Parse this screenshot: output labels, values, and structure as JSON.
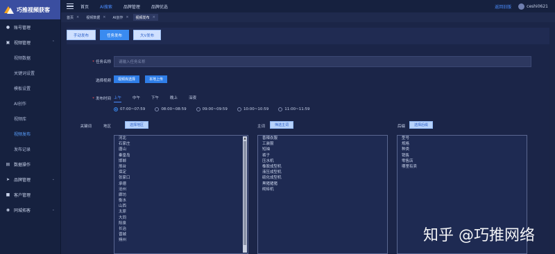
{
  "app": {
    "logo_text": "巧推视频获客"
  },
  "sidebar": {
    "items": [
      {
        "label": "账号管理",
        "icon": "user-icon"
      },
      {
        "label": "视频管理",
        "icon": "video-icon",
        "expanded": true,
        "subitems": [
          "视频数据",
          "关键词设置",
          "模板设置",
          "AI创作",
          "视频库",
          "视频发布",
          "发布记录"
        ]
      },
      {
        "label": "数据操作",
        "icon": "data-icon"
      },
      {
        "label": "品牌管理",
        "icon": "send-icon"
      },
      {
        "label": "客户管理",
        "icon": "customer-icon"
      },
      {
        "label": "同城拓客",
        "icon": "location-icon"
      }
    ],
    "active_sub": "视频发布"
  },
  "topbar": {
    "links": [
      "首页",
      "AI搜索",
      "品牌管理",
      "品牌优选"
    ],
    "active_link": "AI搜索",
    "right_link": "返回旧版",
    "username": "ceshi0621"
  },
  "tabs": [
    {
      "label": "首页"
    },
    {
      "label": "视频数据"
    },
    {
      "label": "AI创作"
    },
    {
      "label": "视频发布",
      "active": true
    }
  ],
  "toolbar": {
    "buttons": [
      "手动发布",
      "任务发布",
      "大V发布"
    ],
    "active_index": 1
  },
  "form": {
    "task_name_label": "任务名称",
    "task_name_placeholder": "请输入任务名称",
    "select_video_label": "选择视频",
    "select_video_btn": "视频库选择",
    "upload_btn": "本地上传",
    "publish_time_label": "发布时间",
    "time_tabs": [
      "上午",
      "中午",
      "下午",
      "晚上",
      "深夜"
    ],
    "active_time_tab": "上午",
    "time_options": [
      "07:00~07:59",
      "08:00~08:59",
      "09:00~09:59",
      "10:00~10:59",
      "11:00~11:59"
    ],
    "selected_time_index": 0,
    "keyword_label": "关键词",
    "region_label": "地区",
    "region_btn": "选择地区",
    "main_label": "主词",
    "main_btn": "筛选主词",
    "suffix_label": "后缀",
    "suffix_btn": "选择后缀",
    "regions": [
      "河北",
      "石家庄",
      "唐山",
      "秦皇岛",
      "邯郸",
      "邢台",
      "保定",
      "张家口",
      "承德",
      "沧州",
      "廊坊",
      "衡水",
      "山西",
      "太原",
      "大同",
      "阳泉",
      "长治",
      "晋城",
      "朔州"
    ],
    "main_words": [
      "香辣衣服",
      "工装服",
      "短袖",
      "裤子",
      "压水机",
      "橡胶成型机",
      "液压成型机",
      "硫化成型机",
      "黑猪猪猪",
      "砌砖机"
    ],
    "suffixes": [
      "型号",
      "规格",
      "种类",
      "销售",
      "零售店",
      "哪里有卖"
    ]
  },
  "watermark": "知乎 @巧推网络"
}
